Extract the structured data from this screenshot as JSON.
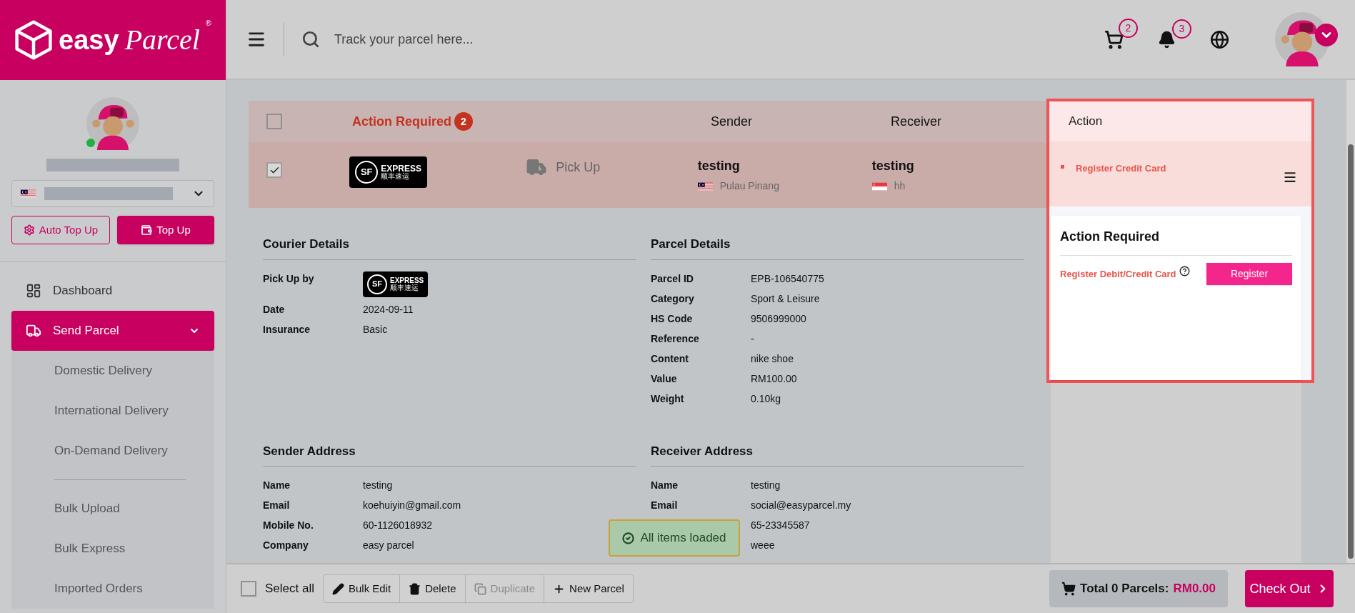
{
  "brand": {
    "word1": "easy",
    "word2": "Parcel",
    "mark": "®"
  },
  "topbar": {
    "search_placeholder": "Track your parcel here...",
    "cart_count": "2",
    "notification_count": "3"
  },
  "sidebar": {
    "online": true,
    "buttons": [
      {
        "label": "Auto Top Up",
        "kind": "outline"
      },
      {
        "label": "Top Up",
        "kind": "solid"
      }
    ],
    "nav": [
      {
        "label": "Dashboard",
        "selected": false
      },
      {
        "label": "Send Parcel",
        "selected": true,
        "expanded": true,
        "children": [
          {
            "kind": "link",
            "label": "Domestic Delivery"
          },
          {
            "kind": "link",
            "label": "International Delivery"
          },
          {
            "kind": "link",
            "label": "On-Demand Delivery"
          },
          {
            "kind": "divider"
          },
          {
            "kind": "link",
            "label": "Bulk Upload"
          },
          {
            "kind": "link",
            "label": "Bulk Express"
          },
          {
            "kind": "link",
            "label": "Imported Orders"
          }
        ]
      }
    ]
  },
  "table": {
    "header": {
      "checked": false,
      "status": "Action Required",
      "status_count": "2",
      "sender": "Sender",
      "receiver": "Receiver",
      "action": "Action"
    },
    "rows": [
      {
        "checked": true,
        "courier": {
          "mark": "SF",
          "name": "EXPRESS",
          "name_cn": "顺丰速运"
        },
        "service": "Pick Up",
        "sender": {
          "name": "testing",
          "location": "Pulau Pinang"
        },
        "receiver": {
          "name": "testing",
          "location": "hh"
        },
        "action": "Register Credit Card"
      }
    ]
  },
  "details": [
    {
      "title": "Courier Details",
      "fields": [
        {
          "label": "Pick Up by",
          "kind": "logo",
          "logo": {
            "mark": "SF",
            "name": "EXPRESS",
            "name_cn": "顺丰速运"
          }
        },
        {
          "label": "Date",
          "kind": "text",
          "value": "2024-09-11"
        },
        {
          "label": "Insurance",
          "kind": "text",
          "value": "Basic"
        }
      ]
    },
    {
      "title": "Parcel Details",
      "fields": [
        {
          "label": "Parcel ID",
          "kind": "text",
          "value": "EPB-106540775"
        },
        {
          "label": "Category",
          "kind": "text",
          "value": "Sport & Leisure"
        },
        {
          "label": "HS Code",
          "kind": "text",
          "value": "9506999000"
        },
        {
          "label": "Reference",
          "kind": "text",
          "value": "-"
        },
        {
          "label": "Content",
          "kind": "text",
          "value": "nike shoe"
        },
        {
          "label": "Value",
          "kind": "text",
          "value": "RM100.00"
        },
        {
          "label": "Weight",
          "kind": "text",
          "value": "0.10kg"
        }
      ]
    },
    {
      "title": "Sender Address",
      "fields": [
        {
          "label": "Name",
          "kind": "text",
          "value": "testing"
        },
        {
          "label": "Email",
          "kind": "text",
          "value": "koehuiyin@gmail.com"
        },
        {
          "label": "Mobile No.",
          "kind": "text",
          "value": "60-1126018932"
        },
        {
          "label": "Company",
          "kind": "text",
          "value": "easy parcel"
        }
      ]
    },
    {
      "title": "Receiver Address",
      "fields": [
        {
          "label": "Name",
          "kind": "text",
          "value": "testing"
        },
        {
          "label": "Email",
          "kind": "text",
          "value": "social@easyparcel.my"
        },
        {
          "kind": "text",
          "value": "65-23345587"
        },
        {
          "kind": "text",
          "value": "weee"
        }
      ]
    }
  ],
  "action_card": {
    "title": "Action Required",
    "item": "Register Debit/Credit Card",
    "button": "Register"
  },
  "toast": {
    "text": "All items loaded"
  },
  "bottom_bar": {
    "select_all": {
      "label": "Select all",
      "checked": false
    },
    "buttons": [
      {
        "label": "Bulk Edit",
        "disabled": false
      },
      {
        "label": "Delete",
        "disabled": false
      },
      {
        "label": "Duplicate",
        "disabled": true
      },
      {
        "label": "New Parcel",
        "disabled": false
      }
    ],
    "total_label": "Total 0 Parcels:",
    "total_amount": "RM0.00",
    "checkout": "Check Out"
  }
}
